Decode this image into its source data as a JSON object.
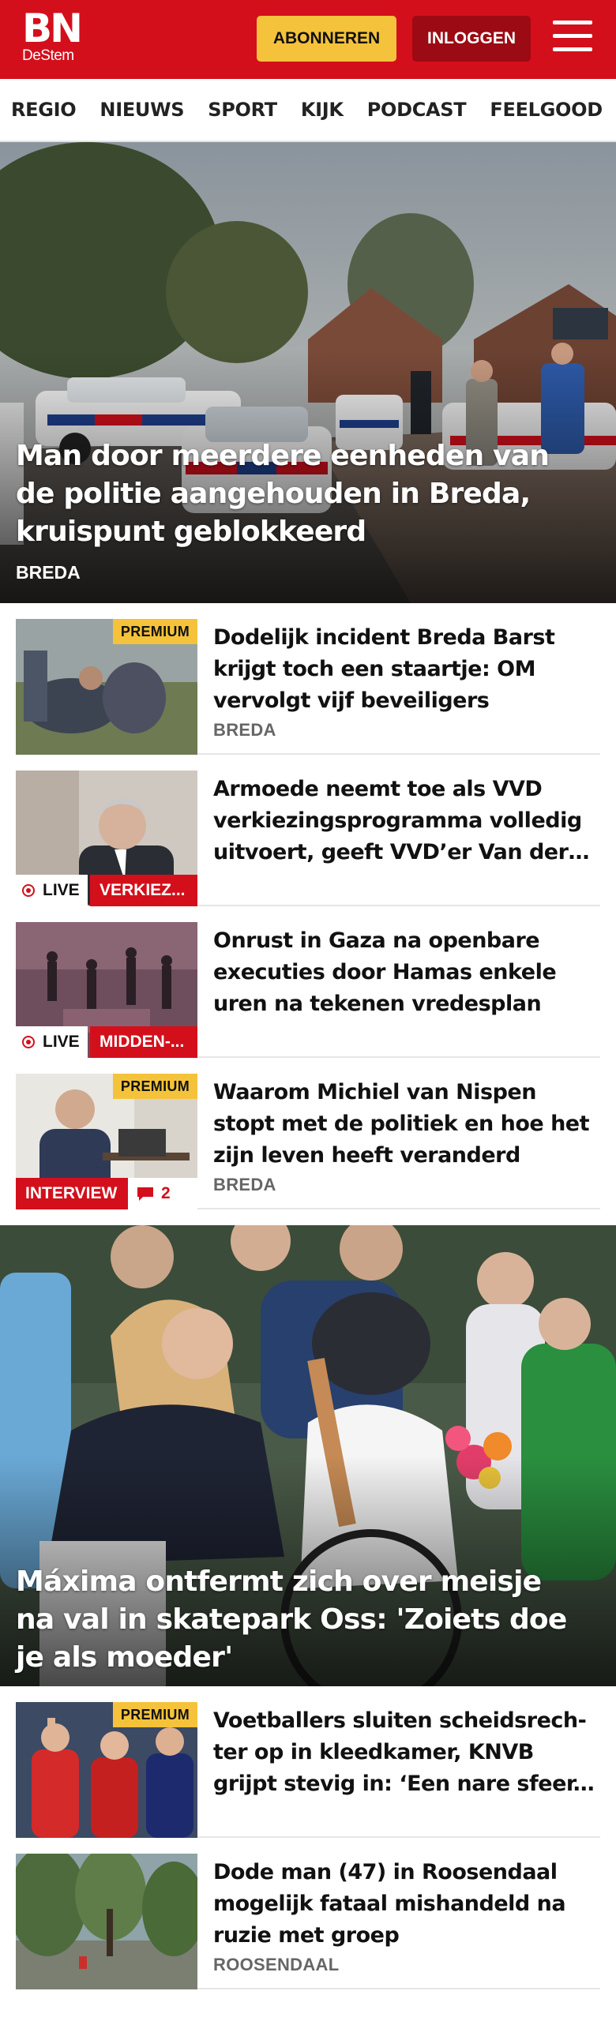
{
  "header": {
    "logo_main": "BN",
    "logo_sub": "DeStem",
    "subscribe_label": "ABONNEREN",
    "login_label": "INLOGGEN",
    "menu_icon": "hamburger-menu-icon",
    "colors": {
      "brand": "#d40f1c",
      "subscribe": "#f5c33b",
      "login": "#9c0a14"
    }
  },
  "nav": {
    "items": [
      "REGIO",
      "NIEUWS",
      "SPORT",
      "KIJK",
      "PODCAST",
      "FEELGOOD"
    ]
  },
  "hero1": {
    "title": "Man door meerdere eenheden van de politie aangehouden in Breda, kruispunt geblokkeerd",
    "category": "BREDA"
  },
  "articles": [
    {
      "title": "Dodelijk incident Breda Barst krijgt toch een staartje: OM vervolgt vijf beveiligers",
      "category": "BREDA",
      "premium": "PREMIUM"
    },
    {
      "title": "Armoede neemt toe als VVD verkiezingsprogramma volledig uitvoert, geeft VVD’er Van der Burg toe",
      "live": "LIVE",
      "tag": "VERKIEZ..."
    },
    {
      "title": "Onrust in Gaza na openbare executies door Hamas enkele uren na tekenen vredesplan",
      "live": "LIVE",
      "tag": "MIDDEN-..."
    },
    {
      "title": "Waarom Michiel van Nispen stopt met de politiek en hoe het zijn leven heeft veranderd",
      "category": "BREDA",
      "premium": "PREMIUM",
      "tag": "INTERVIEW",
      "comments": "2"
    }
  ],
  "hero2": {
    "title": "Máxima ontfermt zich over meisje na val in skatepark Oss: 'Zoiets doe je als moeder'"
  },
  "articles2": [
    {
      "title": "Voetballers sluiten scheidsrech­ter op in kleedkamer, KNVB grijpt stevig in: ‘Een nare sfeer, ik wild­e weg’",
      "premium": "PREMIUM"
    },
    {
      "title": "Dode man (47) in Roosendaal mogelijk fataal mishandeld na ruzie met groep",
      "category": "ROOSENDAAL"
    }
  ]
}
